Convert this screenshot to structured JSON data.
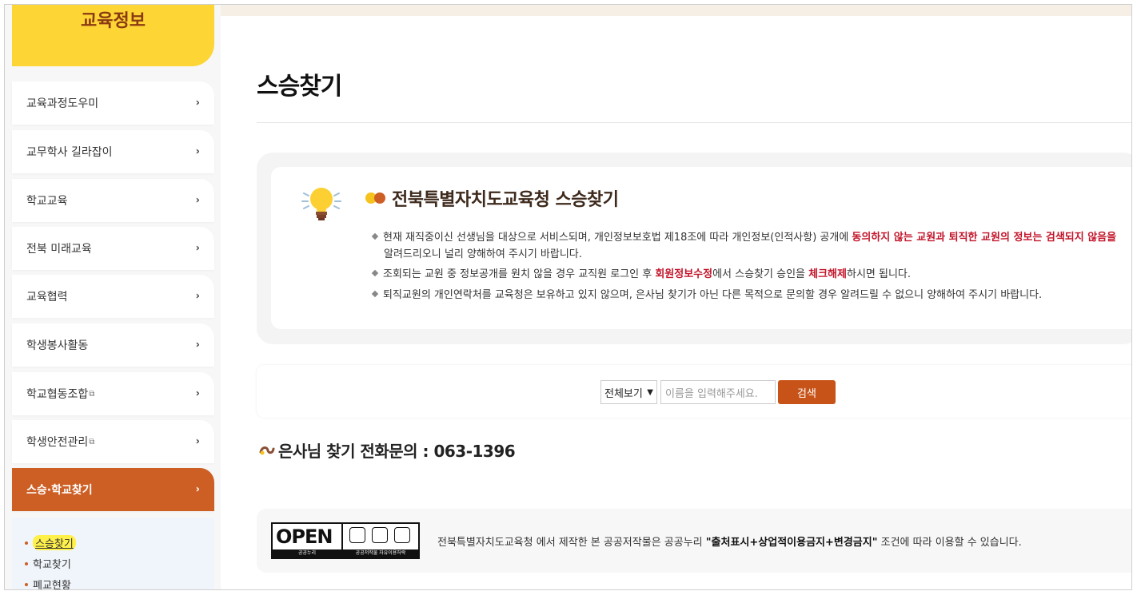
{
  "sidebar": {
    "header": "교육정보",
    "items": [
      {
        "label": "교육과정도우미",
        "ext": ""
      },
      {
        "label": "교무학사 길라잡이",
        "ext": ""
      },
      {
        "label": "학교교육",
        "ext": ""
      },
      {
        "label": "전북 미래교육",
        "ext": ""
      },
      {
        "label": "교육협력",
        "ext": ""
      },
      {
        "label": "학생봉사활동",
        "ext": ""
      },
      {
        "label": "학교협동조합",
        "ext": "⧉"
      },
      {
        "label": "학생안전관리",
        "ext": "⧉"
      },
      {
        "label": "스승·학교찾기",
        "ext": ""
      }
    ],
    "chevron": "›",
    "submenu": [
      "스승찾기",
      "학교찾기",
      "폐교현황"
    ]
  },
  "main": {
    "title": "스승찾기",
    "info": {
      "heading": "전북특별자치도교육청 스승찾기",
      "bullet1_a": "현재 재직중이신 선생님을 대상으로 서비스되며, 개인정보보호법 제18조에 따라 개인정보(인적사항) 공개에 ",
      "bullet1_red": "동의하지 않는 교원과 퇴직한 교원의 정보는 검색되지 않음을",
      "bullet1_b": "알려드리오니 널리 양해하여 주시기 바랍니다.",
      "bullet2_a": "조회되는 교원 중 정보공개를 원치 않을 경우 교직원 로그인 후 ",
      "bullet2_red1": "회원정보수정",
      "bullet2_b": "에서 스승찾기 승인을 ",
      "bullet2_red2": "체크해제",
      "bullet2_c": "하시면 됩니다.",
      "bullet3": "퇴직교원의 개인연락처를 교육청은 보유하고 있지 않으며, 은사님 찾기가 아닌 다른 목적으로 문의할 경우 알려드릴 수 없으니 양해하여 주시기 바랍니다."
    },
    "search": {
      "select_value": "전체보기",
      "placeholder": "이름을 입력해주세요.",
      "button": "검색"
    },
    "phone": "은사님 찾기 전화문의 : 063-1396",
    "kogl": {
      "open": "OPEN",
      "open_caption": "공공누리",
      "icons_caption": "공공저작물 자유이용허락"
    },
    "license": {
      "prefix": "전북특별자치도교육청 에서 제작한 본 공공저작물은 공공누리 ",
      "bold": "\"출처표시+상업적이용금지+변경금지\"",
      "suffix": " 조건에 따라 이용할 수 있습니다."
    }
  },
  "colors": {
    "accent": "#cd5f25",
    "header_yellow": "#fdd535",
    "alert_red": "#c2152a"
  }
}
